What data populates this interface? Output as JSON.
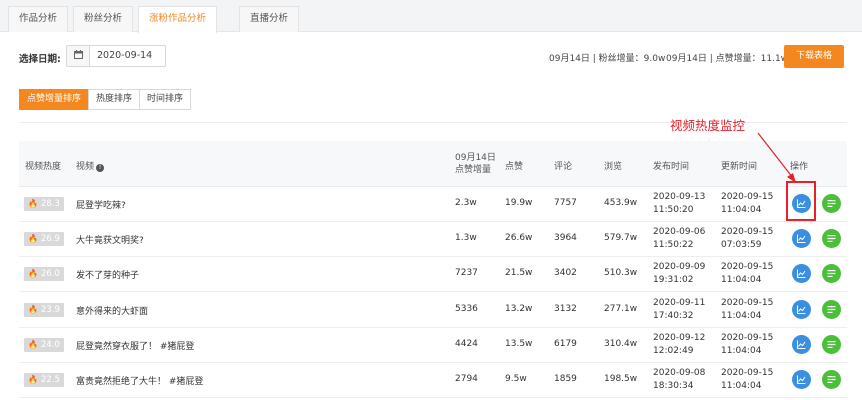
{
  "tabs": [
    {
      "label": "作品分析",
      "active": false
    },
    {
      "label": "粉丝分析",
      "active": false
    },
    {
      "label": "涨粉作品分析",
      "active": true
    },
    {
      "label": "直播分析",
      "active": false
    }
  ],
  "filter": {
    "date_label": "选择日期:",
    "date_value": "2020-09-14",
    "calendar_icon": "calendar-icon"
  },
  "summary": {
    "fans": "09月14日 | 粉丝增量：9.0w",
    "likes": "09月14日 | 点赞增量：11.1w"
  },
  "download_label": "下载表格",
  "sort_buttons": [
    {
      "label": "点赞增量排序",
      "active": true
    },
    {
      "label": "热度排序",
      "active": false
    },
    {
      "label": "时间排序",
      "active": false
    }
  ],
  "table": {
    "headers": {
      "heat": "视频热度",
      "video": "视频",
      "likes_inc_line1": "09月14日",
      "likes_inc_line2": "点赞增量",
      "likes": "点赞",
      "comments": "评论",
      "views": "浏览",
      "published": "发布时间",
      "updated": "更新时间",
      "actions": "操作"
    },
    "rows": [
      {
        "heat": "28.3",
        "title": "屁登学吃辣?",
        "likes_inc": "2.3w",
        "likes": "19.9w",
        "comments": "7757",
        "views": "453.9w",
        "pub_date": "2020-09-13",
        "pub_time": "11:50:20",
        "upd_date": "2020-09-15",
        "upd_time": "11:04:04"
      },
      {
        "heat": "26.9",
        "title": "大牛竟获文明奖?",
        "likes_inc": "1.3w",
        "likes": "26.6w",
        "comments": "3964",
        "views": "579.7w",
        "pub_date": "2020-09-06",
        "pub_time": "11:50:22",
        "upd_date": "2020-09-15",
        "upd_time": "07:03:59"
      },
      {
        "heat": "26.0",
        "title": "发不了芽的种子",
        "likes_inc": "7237",
        "likes": "21.5w",
        "comments": "3402",
        "views": "510.3w",
        "pub_date": "2020-09-09",
        "pub_time": "19:31:02",
        "upd_date": "2020-09-15",
        "upd_time": "11:04:04"
      },
      {
        "heat": "23.9",
        "title": "意外得来的大虾面",
        "likes_inc": "5336",
        "likes": "13.2w",
        "comments": "3132",
        "views": "277.1w",
        "pub_date": "2020-09-11",
        "pub_time": "17:40:32",
        "upd_date": "2020-09-15",
        "upd_time": "11:04:04"
      },
      {
        "heat": "24.0",
        "title": "屁登竟然穿衣服了！ #猪屁登",
        "likes_inc": "4424",
        "likes": "13.5w",
        "comments": "6179",
        "views": "310.4w",
        "pub_date": "2020-09-12",
        "pub_time": "12:02:49",
        "upd_date": "2020-09-15",
        "upd_time": "11:04:04"
      },
      {
        "heat": "22.5",
        "title": "富贵竟然拒绝了大牛！ #猪屁登",
        "likes_inc": "2794",
        "likes": "9.5w",
        "comments": "1859",
        "views": "198.5w",
        "pub_date": "2020-09-08",
        "pub_time": "18:30:34",
        "upd_date": "2020-09-15",
        "upd_time": "11:04:04"
      }
    ]
  },
  "annotation": {
    "text": "视频热度监控",
    "color": "#e8202a"
  },
  "colors": {
    "accent": "#f5871f",
    "chart_button": "#3b8fe0",
    "list_button": "#4cbf3a"
  }
}
